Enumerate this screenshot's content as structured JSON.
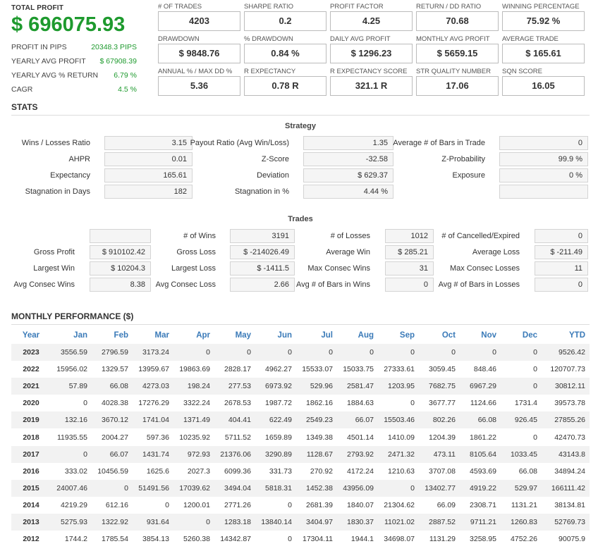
{
  "summary": {
    "total_profit_label": "TOTAL PROFIT",
    "total_profit_value": "$ 696075.93",
    "stats": [
      {
        "label": "PROFIT IN PIPS",
        "value": "20348.3 PIPS"
      },
      {
        "label": "YEARLY AVG PROFIT",
        "value": "$ 67908.39"
      },
      {
        "label": "YEARLY AVG % RETURN",
        "value": "6.79 %"
      },
      {
        "label": "CAGR",
        "value": "4.5 %"
      }
    ]
  },
  "metrics": [
    {
      "label": "# OF TRADES",
      "value": "4203"
    },
    {
      "label": "SHARPE RATIO",
      "value": "0.2"
    },
    {
      "label": "PROFIT FACTOR",
      "value": "4.25"
    },
    {
      "label": "RETURN / DD RATIO",
      "value": "70.68"
    },
    {
      "label": "WINNING PERCENTAGE",
      "value": "75.92 %"
    },
    {
      "label": "DRAWDOWN",
      "value": "$ 9848.76"
    },
    {
      "label": "% DRAWDOWN",
      "value": "0.84 %"
    },
    {
      "label": "DAILY AVG PROFIT",
      "value": "$ 1296.23"
    },
    {
      "label": "MONTHLY AVG PROFIT",
      "value": "$ 5659.15"
    },
    {
      "label": "AVERAGE TRADE",
      "value": "$ 165.61"
    },
    {
      "label": "ANNUAL % / MAX DD %",
      "value": "5.36"
    },
    {
      "label": "R EXPECTANCY",
      "value": "0.78 R"
    },
    {
      "label": "R EXPECTANCY SCORE",
      "value": "321.1 R"
    },
    {
      "label": "STR QUALITY NUMBER",
      "value": "17.06"
    },
    {
      "label": "SQN SCORE",
      "value": "16.05"
    }
  ],
  "stats": {
    "title": "STATS",
    "strategy": {
      "title": "Strategy",
      "rows": [
        [
          {
            "label": "Wins / Losses Ratio",
            "value": "3.15"
          },
          {
            "label": "Payout Ratio (Avg Win/Loss)",
            "value": "1.35"
          },
          {
            "label": "Average # of Bars in Trade",
            "value": "0"
          }
        ],
        [
          {
            "label": "AHPR",
            "value": "0.01"
          },
          {
            "label": "Z-Score",
            "value": "-32.58"
          },
          {
            "label": "Z-Probability",
            "value": "99.9 %"
          }
        ],
        [
          {
            "label": "Expectancy",
            "value": "165.61"
          },
          {
            "label": "Deviation",
            "value": "$ 629.37"
          },
          {
            "label": "Exposure",
            "value": "0 %"
          }
        ],
        [
          {
            "label": "Stagnation in Days",
            "value": "182"
          },
          {
            "label": "Stagnation in %",
            "value": "4.44 %"
          },
          {
            "label": "",
            "value": ""
          }
        ]
      ]
    },
    "trades": {
      "title": "Trades",
      "rows": [
        [
          {
            "label": "",
            "value": ""
          },
          {
            "label": "# of Wins",
            "value": "3191"
          },
          {
            "label": "# of Losses",
            "value": "1012"
          },
          {
            "label": "# of Cancelled/Expired",
            "value": "0"
          }
        ],
        [
          {
            "label": "Gross Profit",
            "value": "$ 910102.42"
          },
          {
            "label": "Gross Loss",
            "value": "$ -214026.49"
          },
          {
            "label": "Average Win",
            "value": "$ 285.21"
          },
          {
            "label": "Average Loss",
            "value": "$ -211.49"
          }
        ],
        [
          {
            "label": "Largest Win",
            "value": "$ 10204.3"
          },
          {
            "label": "Largest Loss",
            "value": "$ -1411.5"
          },
          {
            "label": "Max Consec Wins",
            "value": "31"
          },
          {
            "label": "Max Consec Losses",
            "value": "11"
          }
        ],
        [
          {
            "label": "Avg Consec Wins",
            "value": "8.38"
          },
          {
            "label": "Avg Consec Loss",
            "value": "2.66"
          },
          {
            "label": "Avg # of Bars in Wins",
            "value": "0"
          },
          {
            "label": "Avg # of Bars in Losses",
            "value": "0"
          }
        ]
      ]
    }
  },
  "monthly": {
    "title": "MONTHLY PERFORMANCE ($)",
    "headers": [
      "Year",
      "Jan",
      "Feb",
      "Mar",
      "Apr",
      "May",
      "Jun",
      "Jul",
      "Aug",
      "Sep",
      "Oct",
      "Nov",
      "Dec",
      "YTD"
    ],
    "rows": [
      [
        "2023",
        "3556.59",
        "2796.59",
        "3173.24",
        "0",
        "0",
        "0",
        "0",
        "0",
        "0",
        "0",
        "0",
        "0",
        "9526.42"
      ],
      [
        "2022",
        "15956.02",
        "1329.57",
        "13959.67",
        "19863.69",
        "2828.17",
        "4962.27",
        "15533.07",
        "15033.75",
        "27333.61",
        "3059.45",
        "848.46",
        "0",
        "120707.73"
      ],
      [
        "2021",
        "57.89",
        "66.08",
        "4273.03",
        "198.24",
        "277.53",
        "6973.92",
        "529.96",
        "2581.47",
        "1203.95",
        "7682.75",
        "6967.29",
        "0",
        "30812.11"
      ],
      [
        "2020",
        "0",
        "4028.38",
        "17276.29",
        "3322.24",
        "2678.53",
        "1987.72",
        "1862.16",
        "1884.63",
        "0",
        "3677.77",
        "1124.66",
        "1731.4",
        "39573.78"
      ],
      [
        "2019",
        "132.16",
        "3670.12",
        "1741.04",
        "1371.49",
        "404.41",
        "622.49",
        "2549.23",
        "66.07",
        "15503.46",
        "802.26",
        "66.08",
        "926.45",
        "27855.26"
      ],
      [
        "2018",
        "11935.55",
        "2004.27",
        "597.36",
        "10235.92",
        "5711.52",
        "1659.89",
        "1349.38",
        "4501.14",
        "1410.09",
        "1204.39",
        "1861.22",
        "0",
        "42470.73"
      ],
      [
        "2017",
        "0",
        "66.07",
        "1431.74",
        "972.93",
        "21376.06",
        "3290.89",
        "1128.67",
        "2793.92",
        "2471.32",
        "473.11",
        "8105.64",
        "1033.45",
        "43143.8"
      ],
      [
        "2016",
        "333.02",
        "10456.59",
        "1625.6",
        "2027.3",
        "6099.36",
        "331.73",
        "270.92",
        "4172.24",
        "1210.63",
        "3707.08",
        "4593.69",
        "66.08",
        "34894.24"
      ],
      [
        "2015",
        "24007.46",
        "0",
        "51491.56",
        "17039.62",
        "3494.04",
        "5818.31",
        "1452.38",
        "43956.09",
        "0",
        "13402.77",
        "4919.22",
        "529.97",
        "166111.42"
      ],
      [
        "2014",
        "4219.29",
        "612.16",
        "0",
        "1200.01",
        "2771.26",
        "0",
        "2681.39",
        "1840.07",
        "21304.62",
        "66.09",
        "2308.71",
        "1131.21",
        "38134.81"
      ],
      [
        "2013",
        "5275.93",
        "1322.92",
        "931.64",
        "0",
        "1283.18",
        "13840.14",
        "3404.97",
        "1830.37",
        "11021.02",
        "2887.52",
        "9711.21",
        "1260.83",
        "52769.73"
      ],
      [
        "2012",
        "1744.2",
        "1785.54",
        "3854.13",
        "5260.38",
        "14342.87",
        "0",
        "17304.11",
        "1944.1",
        "34698.07",
        "1131.29",
        "3258.95",
        "4752.26",
        "90075.9"
      ]
    ]
  }
}
